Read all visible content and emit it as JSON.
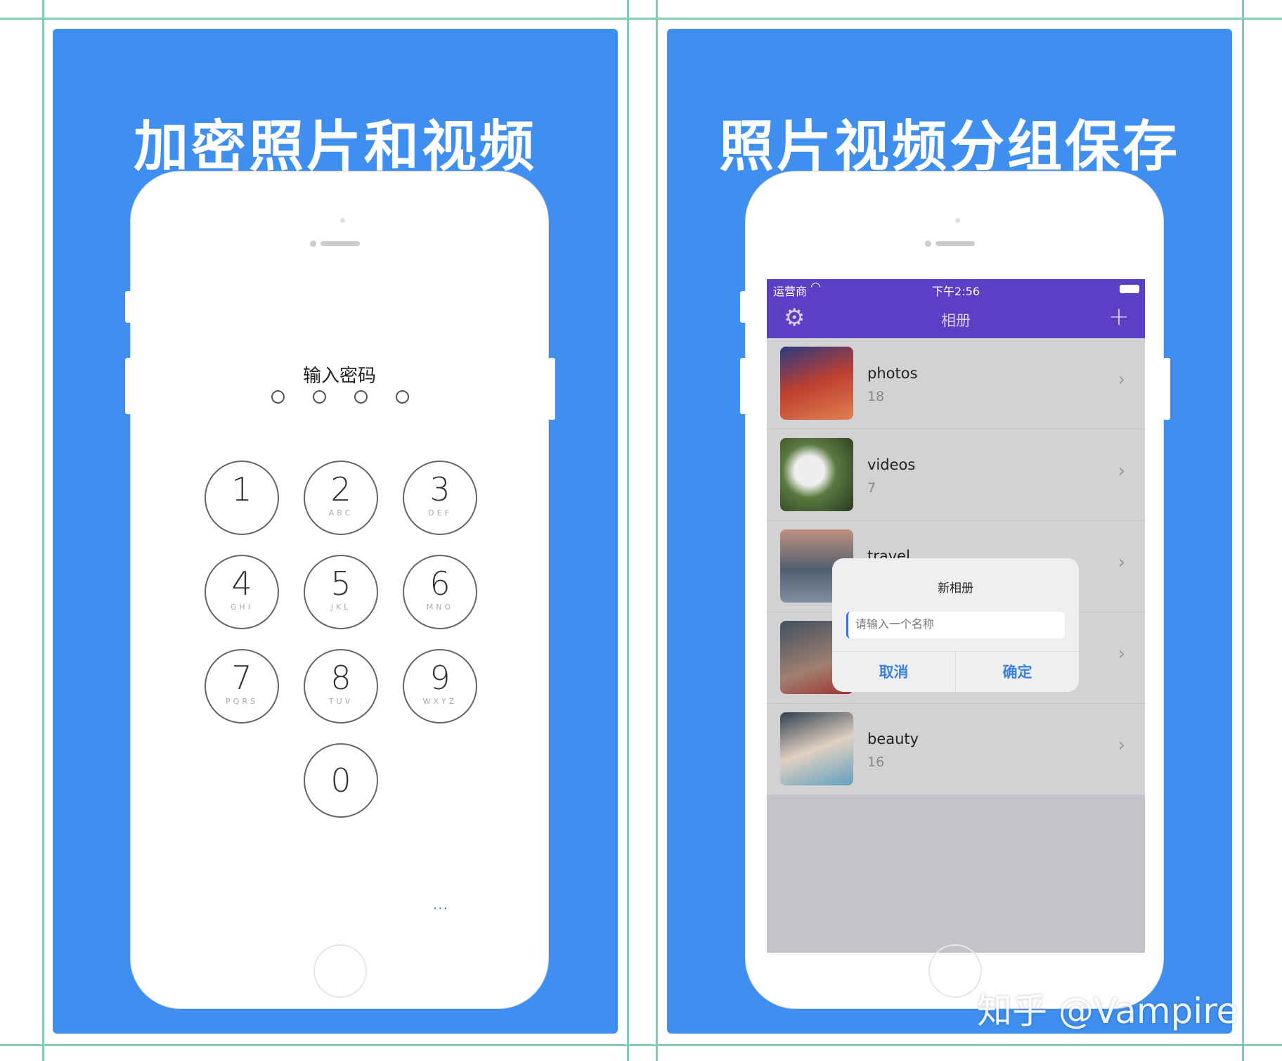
{
  "left": {
    "title": "加密照片和视频",
    "passcode_title": "输入密码",
    "digits": 4,
    "keys": [
      {
        "n": "1",
        "l": ""
      },
      {
        "n": "2",
        "l": "ABC"
      },
      {
        "n": "3",
        "l": "DEF"
      },
      {
        "n": "4",
        "l": "GHI"
      },
      {
        "n": "5",
        "l": "JKL"
      },
      {
        "n": "6",
        "l": "MNO"
      },
      {
        "n": "7",
        "l": "PQRS"
      },
      {
        "n": "8",
        "l": "TUV"
      },
      {
        "n": "9",
        "l": "WXYZ"
      },
      {
        "n": "0",
        "l": ""
      }
    ],
    "more": "..."
  },
  "right": {
    "title": "照片视频分组保存",
    "status": {
      "carrier": "运营商",
      "time": "下午2:56"
    },
    "nav": {
      "title": "相册",
      "left_icon": "gear-icon",
      "right_icon": "plus-icon"
    },
    "albums": [
      {
        "name": "photos",
        "count": "18"
      },
      {
        "name": "videos",
        "count": "7"
      },
      {
        "name": "travel",
        "count": ""
      },
      {
        "name": "",
        "count": ""
      },
      {
        "name": "beauty",
        "count": "16"
      }
    ],
    "dialog": {
      "title": "新相册",
      "placeholder": "请输入一个名称",
      "cancel": "取消",
      "confirm": "确定"
    }
  },
  "watermark": "知乎 @Vampire",
  "colors": {
    "panel": "#3f8ff0",
    "nav": "#5b3fc4",
    "dialog_button": "#3b82e0"
  }
}
